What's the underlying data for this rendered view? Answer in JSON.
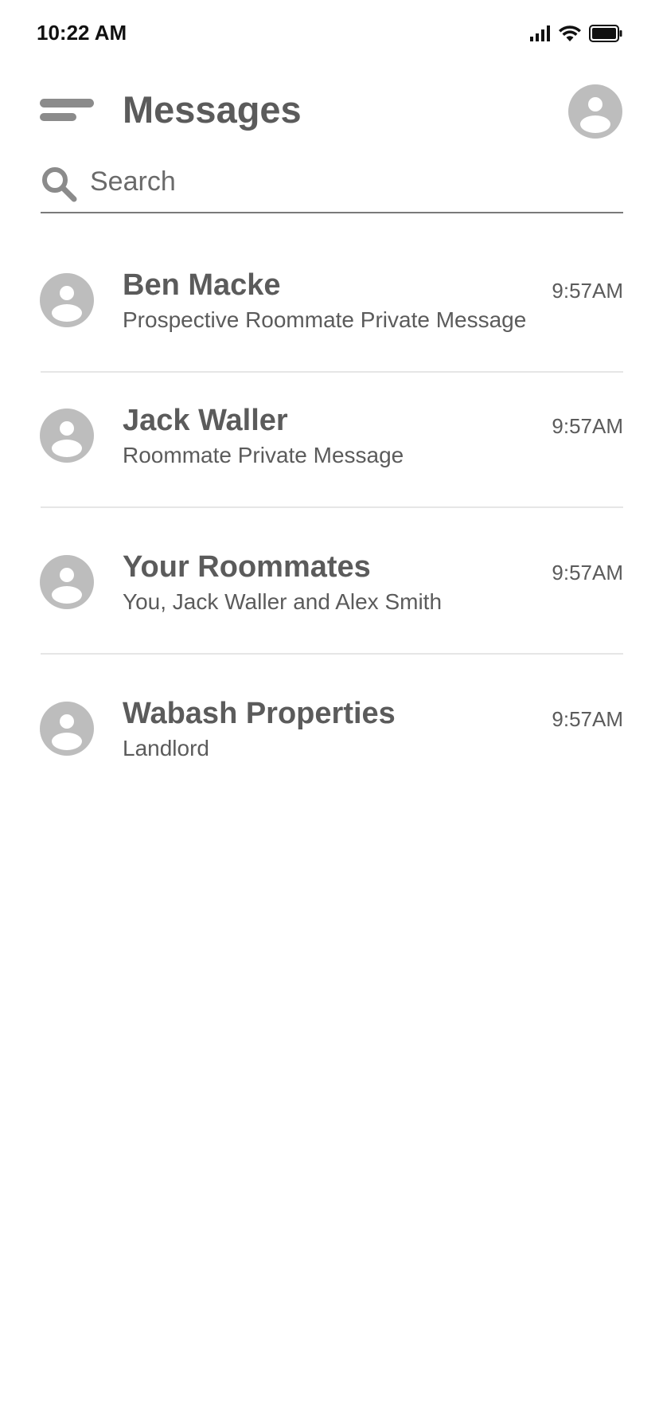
{
  "status_bar": {
    "time": "10:22 AM",
    "icons": [
      "cellular-signal-icon",
      "wifi-icon",
      "battery-icon"
    ]
  },
  "header": {
    "title": "Messages",
    "menu_icon": "menu-icon",
    "profile_icon": "profile-avatar-icon"
  },
  "search": {
    "placeholder": "Search",
    "value": "",
    "icon": "search-icon"
  },
  "conversations": [
    {
      "name": "Ben Macke",
      "preview": "Prospective Roommate Private Message",
      "time": "9:57AM"
    },
    {
      "name": "Jack Waller",
      "preview": "Roommate Private Message",
      "time": "9:57AM"
    },
    {
      "name": "Your Roommates",
      "preview": "You, Jack Waller and Alex Smith",
      "time": "9:57AM"
    },
    {
      "name": "Wabash Properties",
      "preview": "Landlord",
      "time": "9:57AM"
    }
  ],
  "colors": {
    "text": "#5b5b5b",
    "icon_gray": "#8b8b8b",
    "avatar_gray": "#bdbdbd",
    "divider": "#e6e6e6"
  }
}
